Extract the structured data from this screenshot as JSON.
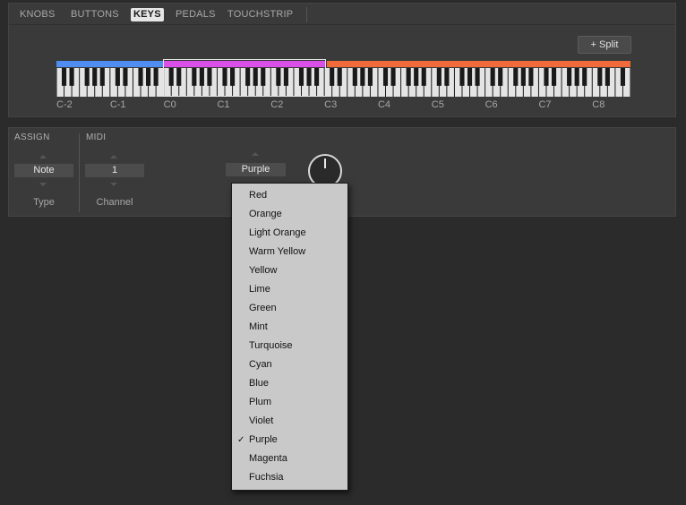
{
  "tabs": [
    {
      "label": "KNOBS",
      "active": false
    },
    {
      "label": "BUTTONS",
      "active": false
    },
    {
      "label": "KEYS",
      "active": true
    },
    {
      "label": "PEDALS",
      "active": false
    },
    {
      "label": "TOUCHSTRIP",
      "active": false
    }
  ],
  "split_label": "+ Split",
  "zones": [
    {
      "color": "#4f8ef0"
    },
    {
      "color": "#d94fe8"
    },
    {
      "color": "#f06a3a"
    }
  ],
  "octave_labels": [
    "C-2",
    "C-1",
    "C0",
    "C1",
    "C2",
    "C3",
    "C4",
    "C5",
    "C6",
    "C7",
    "C8"
  ],
  "assign": {
    "section_label": "ASSIGN",
    "value": "Note",
    "sub_label": "Type"
  },
  "midi": {
    "section_label": "MIDI",
    "value": "1",
    "sub_label": "Channel"
  },
  "color_selector": {
    "value": "Purple"
  },
  "dropdown": {
    "items": [
      "Red",
      "Orange",
      "Light Orange",
      "Warm Yellow",
      "Yellow",
      "Lime",
      "Green",
      "Mint",
      "Turquoise",
      "Cyan",
      "Blue",
      "Plum",
      "Violet",
      "Purple",
      "Magenta",
      "Fuchsia"
    ],
    "checked": "Purple",
    "check_mark": "✓"
  },
  "icons": {
    "check": "check-icon",
    "arrow_up": "arrow-up-icon",
    "arrow_down": "arrow-down-icon"
  }
}
